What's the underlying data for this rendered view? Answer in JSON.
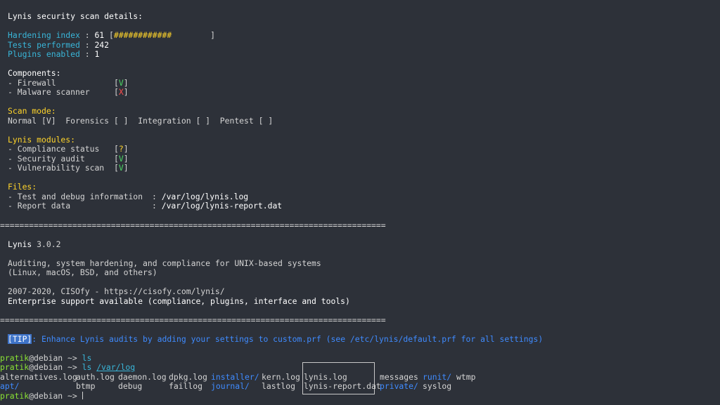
{
  "header": "Lynis security scan details:",
  "hardening": {
    "label": "Hardening index",
    "value": "61",
    "bar": "[############        ]",
    "percent": 61
  },
  "tests": {
    "label": "Tests performed",
    "value": "242"
  },
  "plugins": {
    "label": "Plugins enabled",
    "value": "1"
  },
  "components": {
    "title": "Components:",
    "items": [
      {
        "label": "- Firewall",
        "status": "V"
      },
      {
        "label": "- Malware scanner",
        "status": "X"
      }
    ]
  },
  "scan_mode": {
    "title": "Scan mode:",
    "line": "Normal [V]  Forensics [ ]  Integration [ ]  Pentest [ ]"
  },
  "modules": {
    "title": "Lynis modules:",
    "items": [
      {
        "label": "- Compliance status",
        "status": "?"
      },
      {
        "label": "- Security audit",
        "status": "V"
      },
      {
        "label": "- Vulnerability scan",
        "status": "V"
      }
    ]
  },
  "files": {
    "title": "Files:",
    "items": [
      {
        "label": "- Test and debug information",
        "path": "/var/log/lynis.log"
      },
      {
        "label": "- Report data",
        "path": "/var/log/lynis-report.dat"
      }
    ]
  },
  "separator": "================================================================================",
  "about": {
    "name": "Lynis",
    "version": "3.0.2",
    "desc1": "Auditing, system hardening, and compliance for UNIX-based systems",
    "desc2": "(Linux, macOS, BSD, and others)",
    "copyright": "2007-2020, CISOfy - https://cisofy.com/lynis/",
    "support": "Enterprise support available (compliance, plugins, interface and tools)"
  },
  "tip": {
    "label": "[TIP]",
    "message": ": Enhance Lynis audits by adding your settings to custom.prf (see /etc/lynis/default.prf for all settings)"
  },
  "prompt": {
    "user": "pratik",
    "host": "@debian",
    "arrow": " ~> ",
    "cmd1": "ls",
    "cmd2": "ls",
    "cmd2_arg": "/var/log"
  },
  "ls": {
    "row1": [
      "alternatives.log",
      "auth.log",
      "daemon.log",
      "dpkg.log",
      "installer/",
      "kern.log",
      "lynis.log",
      "messages",
      "runit/",
      "wtmp"
    ],
    "row2": [
      "apt/",
      "btmp",
      "debug",
      "faillog",
      "journal/",
      "lastlog",
      "lynis-report.dat",
      "private/",
      "syslog"
    ]
  },
  "colors": {
    "background": "#2d3139",
    "cyan": "#39b6d9",
    "yellow": "#ffd42a",
    "green": "#4cd964",
    "red": "#ff4d4d",
    "blue": "#3f8bff"
  }
}
